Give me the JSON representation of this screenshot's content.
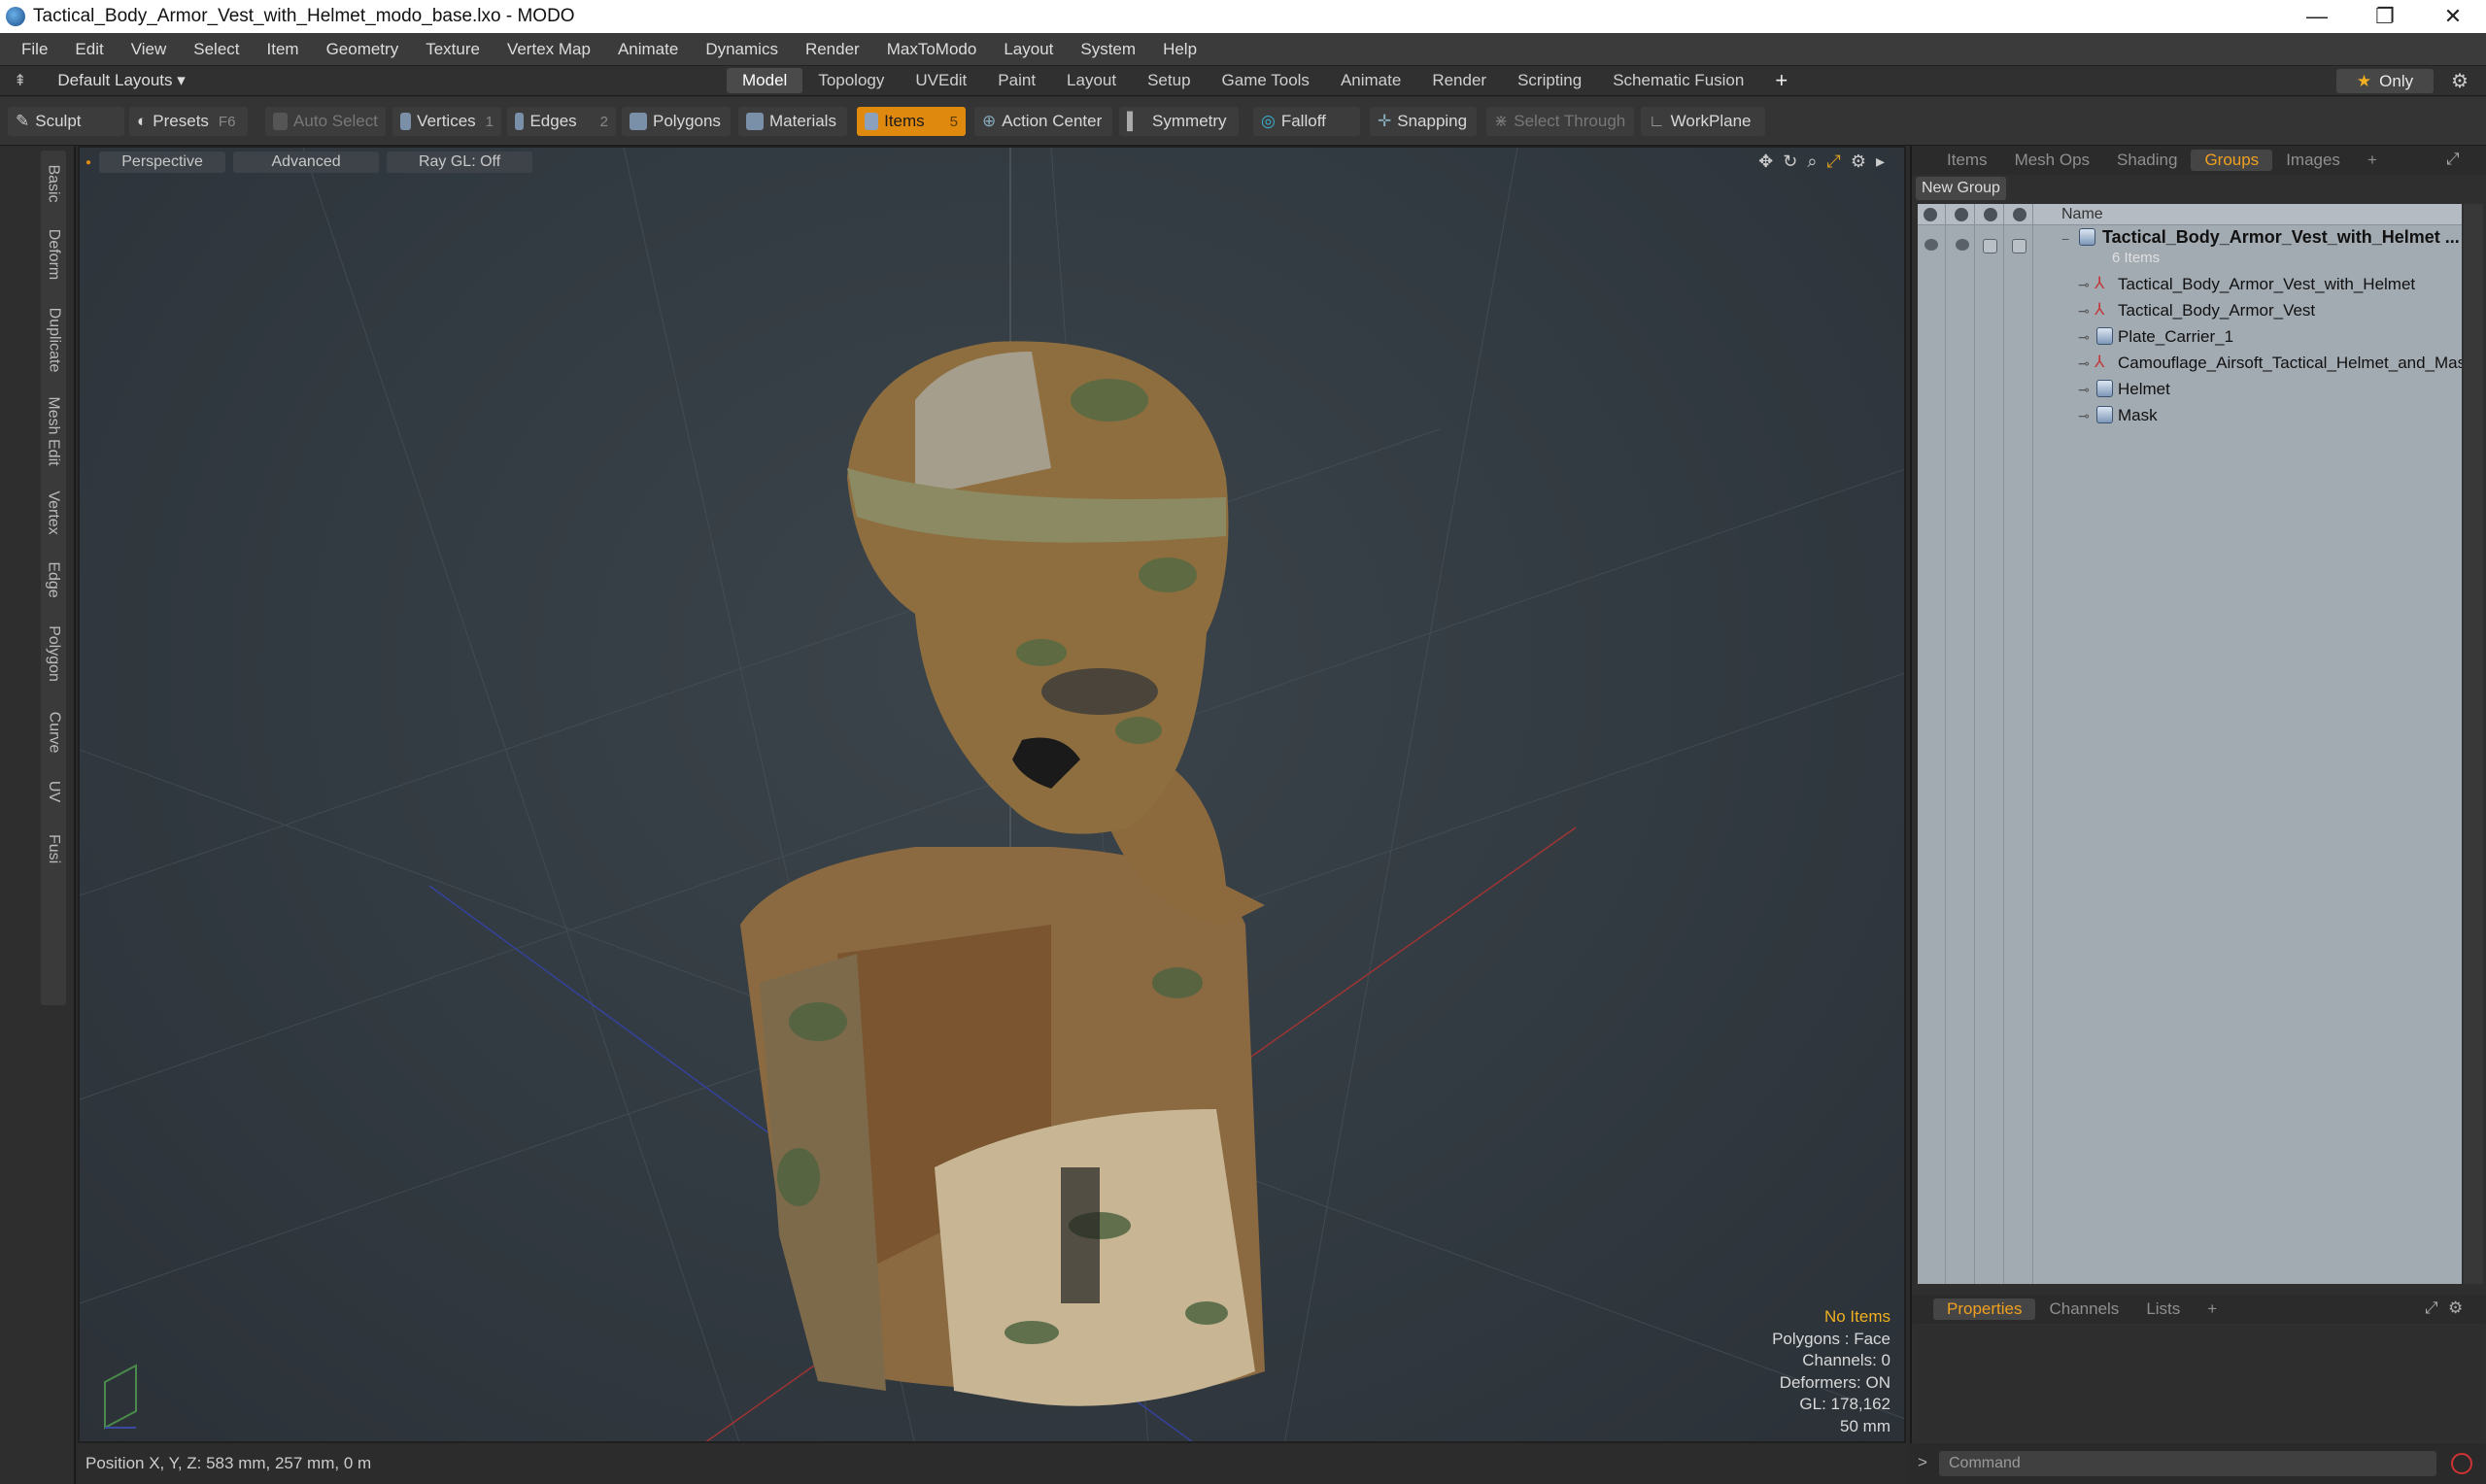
{
  "window": {
    "title": "Tactical_Body_Armor_Vest_with_Helmet_modo_base.lxo - MODO",
    "controls": [
      "—",
      "❐",
      "✕"
    ]
  },
  "menu": [
    "File",
    "Edit",
    "View",
    "Select",
    "Item",
    "Geometry",
    "Texture",
    "Vertex Map",
    "Animate",
    "Dynamics",
    "Render",
    "MaxToModo",
    "Layout",
    "System",
    "Help"
  ],
  "modebar": {
    "layouts_label": "Default Layouts",
    "tabs": [
      "Model",
      "Topology",
      "UVEdit",
      "Paint",
      "Layout",
      "Setup",
      "Game Tools",
      "Animate",
      "Render",
      "Scripting",
      "Schematic Fusion"
    ],
    "active_tab": "Model",
    "add": "+",
    "only_label": "Only"
  },
  "toolbar": {
    "sculpt": "Sculpt",
    "presets": "Presets",
    "presets_key": "F6",
    "auto_select": "Auto Select",
    "vertices": "Vertices",
    "vertices_count": "1",
    "edges": "Edges",
    "edges_count": "2",
    "polygons": "Polygons",
    "materials": "Materials",
    "items": "Items",
    "items_count": "5",
    "action_center": "Action Center",
    "symmetry": "Symmetry",
    "falloff": "Falloff",
    "snapping": "Snapping",
    "select_through": "Select Through",
    "workplane": "WorkPlane"
  },
  "left_tabs": [
    "Basic",
    "Deform",
    "Duplicate",
    "Mesh Edit",
    "Vertex",
    "Edge",
    "Polygon",
    "Curve",
    "UV",
    "Fusion"
  ],
  "viewport": {
    "view": "Perspective",
    "shading": "Advanced",
    "raygl": "Ray GL: Off",
    "info": {
      "selection": "No Items",
      "polygons": "Polygons : Face",
      "channels": "Channels: 0",
      "deformers": "Deformers: ON",
      "gl": "GL: 178,162",
      "scale": "50 mm"
    }
  },
  "status": {
    "position": "Position X, Y, Z:  583 mm, 257 mm, 0 m"
  },
  "right_panel": {
    "tabs": [
      "Items",
      "Mesh Ops",
      "Shading",
      "Groups",
      "Images",
      "+"
    ],
    "active_tab": "Groups",
    "new_group": "New Group",
    "column_name": "Name",
    "group_name": "Tactical_Body_Armor_Vest_with_Helmet ...",
    "group_count": "6 Items",
    "items": [
      {
        "name": "Tactical_Body_Armor_Vest_with_Helmet",
        "kind": "locator"
      },
      {
        "name": "Tactical_Body_Armor_Vest",
        "kind": "locator"
      },
      {
        "name": "Plate_Carrier_1",
        "kind": "mesh"
      },
      {
        "name": "Camouflage_Airsoft_Tactical_Helmet_and_Mask",
        "kind": "locator"
      },
      {
        "name": "Helmet",
        "kind": "mesh"
      },
      {
        "name": "Mask",
        "kind": "mesh"
      }
    ],
    "bottom_tabs": [
      "Properties",
      "Channels",
      "Lists",
      "+"
    ],
    "bottom_active": "Properties",
    "command_placeholder": "Command",
    "command_prompt": ">"
  }
}
